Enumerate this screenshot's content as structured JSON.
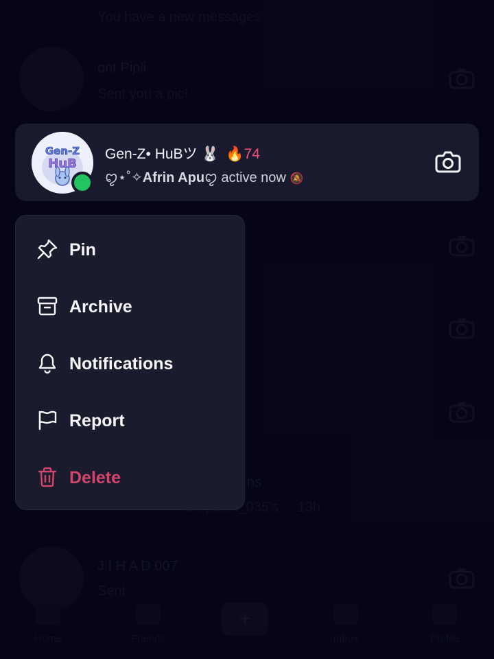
{
  "background_list": [
    {
      "name": "",
      "preview": "You have a new messages"
    },
    {
      "name": "ont Pipli",
      "preview": "Sent you a pic!"
    },
    {
      "name": "",
      "preview": ""
    },
    {
      "name": "",
      "preview": ""
    },
    {
      "name": "",
      "preview": ""
    },
    {
      "name": "ns",
      "preview": "ked pakhi_035's ... 13h"
    },
    {
      "name": "J I H A D 007",
      "preview": "Sent"
    }
  ],
  "bottom_nav": {
    "items": [
      {
        "label": "Home"
      },
      {
        "label": "Friends"
      },
      {
        "label": "Inbox"
      },
      {
        "label": "Profile"
      }
    ],
    "plus_symbol": "+"
  },
  "chat": {
    "name": "Gen-Z• HuBツ 🐰",
    "streak_icon": "🔥",
    "streak_count": "74",
    "status_prefix": "ꨄ︎⋆˚✧",
    "status_user": "Afrin Apu",
    "status_suffix": "ꨄ︎ active now",
    "muted_icon": "🔕",
    "avatar_text": "Gen-Z HuB",
    "online": true
  },
  "menu": {
    "items": [
      {
        "label": "Pin",
        "icon": "pin-icon"
      },
      {
        "label": "Archive",
        "icon": "archive-icon"
      },
      {
        "label": "Notifications",
        "icon": "bell-icon"
      },
      {
        "label": "Report",
        "icon": "flag-icon"
      },
      {
        "label": "Delete",
        "icon": "trash-icon"
      }
    ]
  },
  "colors": {
    "background": "#0a0920",
    "card": "#1a1a2e",
    "online": "#21c45e",
    "streak": "#f1527a",
    "danger": "#d1466a"
  }
}
